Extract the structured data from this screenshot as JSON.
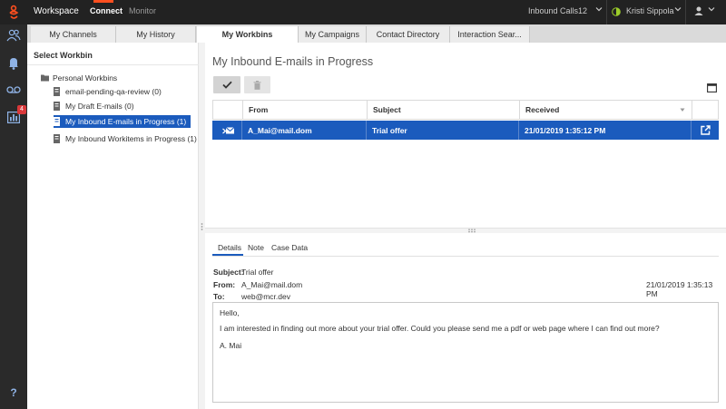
{
  "topbar": {
    "app_title": "Workspace",
    "nav": [
      "Connect",
      "Monitor"
    ],
    "inbound_calls_label": "Inbound Calls",
    "inbound_calls_count": "12",
    "user_name": "Kristi Sippola",
    "user_status_color": "#9ccd2a"
  },
  "rail": {
    "items": [
      "contacts-icon",
      "notifications-icon",
      "voicemail-icon",
      "statistics-icon",
      "help-icon"
    ],
    "statistics_badge": "4",
    "help_label": "?"
  },
  "tabs": [
    "My Channels",
    "My History",
    "My Workbins",
    "My Campaigns",
    "Contact Directory",
    "Interaction Sear..."
  ],
  "workbin_panel": {
    "title": "Select Workbin",
    "root_label": "Personal Workbins",
    "items": [
      "email-pending-qa-review (0)",
      "My Draft E-mails (0)",
      "My Inbound E-mails in Progress (1)",
      "My Inbound Workitems in Progress (1)"
    ]
  },
  "main": {
    "title": "My Inbound E-mails in Progress",
    "columns": [
      "From",
      "Subject",
      "Received"
    ],
    "rows": [
      {
        "from": "A_Mai@mail.dom",
        "subject": "Trial offer",
        "received": "21/01/2019 1:35:12 PM"
      }
    ]
  },
  "details": {
    "tabs": [
      "Details",
      "Note",
      "Case Data"
    ],
    "subject_label": "Subject:",
    "subject": "Trial offer",
    "from_label": "From:",
    "from": "A_Mai@mail.dom",
    "to_label": "To:",
    "to": "web@mcr.dev",
    "date": "21/01/2019 1:35:13 PM",
    "body": [
      "Hello,",
      "I am interested in finding out more about your trial offer. Could you please send me a pdf or web page where I can find out more?",
      "A. Mai"
    ]
  },
  "colors": {
    "accent_blue": "#1b5bbd",
    "brand_orange": "#ff4f1f",
    "topbar_bg": "#222222",
    "badge_red": "#d9383a"
  }
}
